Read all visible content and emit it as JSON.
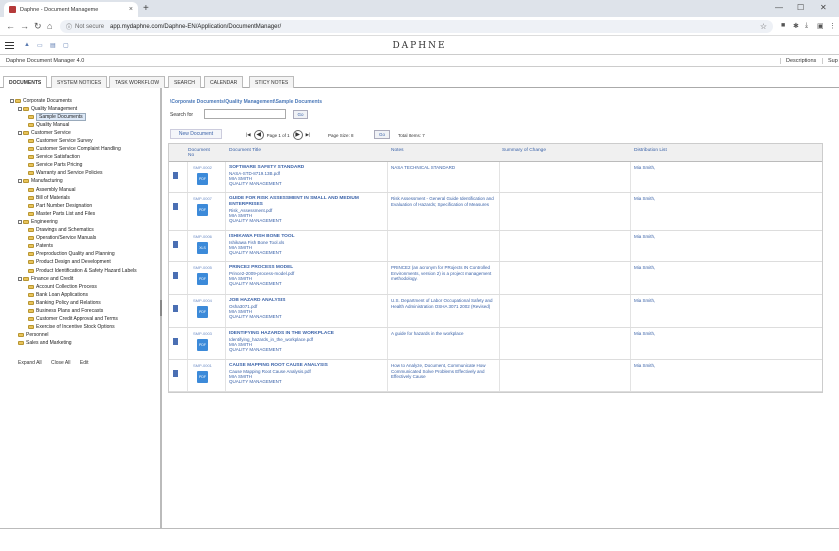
{
  "browser": {
    "tab_title": "Daphne - Document Manageme",
    "tab_close": "×",
    "new_tab": "+",
    "not_secure": "Not secure",
    "url": "app.mydaphne.com/Daphne-EN/Application/DocumentManager/"
  },
  "app": {
    "brand": "DAPHNE",
    "name_version": "Daphne Document Manager  4.0",
    "links": [
      "Descriptions",
      "Sup"
    ]
  },
  "tabs": [
    "DOCUMENTS",
    "SYSTEM NOTICES",
    "TASK WORKFLOW",
    "SEARCH",
    "CALENDAR",
    "STICY NOTES"
  ],
  "tree": {
    "root": "Corporate Documents",
    "items": [
      {
        "label": "Quality Management",
        "level": 1,
        "toggle": "-"
      },
      {
        "label": "Sample Documents",
        "level": 2,
        "selected": true
      },
      {
        "label": "Quality Manual",
        "level": 2
      },
      {
        "label": "Customer Service",
        "level": 1,
        "toggle": "-"
      },
      {
        "label": "Customer Service Survey",
        "level": 2
      },
      {
        "label": "Customer Service Complaint Handling",
        "level": 2
      },
      {
        "label": "Service Satisfaction",
        "level": 2
      },
      {
        "label": "Service Parts Pricing",
        "level": 2
      },
      {
        "label": "Warranty and Service Policies",
        "level": 2
      },
      {
        "label": "Manufacturing",
        "level": 1,
        "toggle": "-"
      },
      {
        "label": "Assembly Manual",
        "level": 2
      },
      {
        "label": "Bill of Materials",
        "level": 2
      },
      {
        "label": "Part Number Designation",
        "level": 2
      },
      {
        "label": "Master Parts List and Files",
        "level": 2
      },
      {
        "label": "Engineering",
        "level": 1,
        "toggle": "-"
      },
      {
        "label": "Drawings and Schematics",
        "level": 2
      },
      {
        "label": "Operation/Service Manuals",
        "level": 2
      },
      {
        "label": "Patents",
        "level": 2
      },
      {
        "label": "Preproduction Quality and Planning",
        "level": 2
      },
      {
        "label": "Product Design and Development",
        "level": 2
      },
      {
        "label": "Product Identification & Safety Hazard Labels",
        "level": 2
      },
      {
        "label": "Finance and Credit",
        "level": 1,
        "toggle": "-"
      },
      {
        "label": "Account Collection Process",
        "level": 2
      },
      {
        "label": "Bank Loan Applications",
        "level": 2
      },
      {
        "label": "Banking Policy and Relations",
        "level": 2
      },
      {
        "label": "Business Plans and Forecasts",
        "level": 2
      },
      {
        "label": "Customer Credit Approval and Terms",
        "level": 2
      },
      {
        "label": "Exercise of Incentive Stock Options",
        "level": 2
      },
      {
        "label": "Personnel",
        "level": 1
      },
      {
        "label": "Sales and Marketing",
        "level": 1
      }
    ],
    "links": [
      "Expand All",
      "Close All",
      "Edit"
    ]
  },
  "content": {
    "breadcrumb": "\\Corporate Documents\\Quality Management\\Sample Documents",
    "search_label": "Search for",
    "go": "Go",
    "new_document": "New Document",
    "page_info": "Page 1 of 1",
    "page_size": "Page Size: 8",
    "total_items": "Total Items: 7",
    "columns": [
      "Document No",
      "Document Title",
      "Notes",
      "Summary of Change",
      "Distribution List"
    ],
    "rows": [
      {
        "no": "SMP-0002",
        "title": "SOFTWARE SAFETY STANDARD",
        "file": "NASA-STD-8719.13B.pdf",
        "author": "MIA SMITH",
        "category": "QUALITY MANAGEMENT",
        "notes": "NASA TECHNICAL STANDARD",
        "dist": "Mia Smith,",
        "icon": "PDF",
        "height": 31
      },
      {
        "no": "SMP-0007",
        "title": "GUIDE FOR RISK ASSESSMENT IN SMALL AND MEDIUM ENTERPRISES",
        "file": "Risk_Assessment.pdf",
        "author": "MIA SMITH",
        "category": "QUALITY MANAGEMENT",
        "notes": "Risk Assessment - General Guide Identification and Evaluation of Hazards; Specification of Measures",
        "dist": "Mia Smith,",
        "icon": "PDF",
        "height": 38
      },
      {
        "no": "SMP-0006",
        "title": "ISHIKAWA FISH BONE TOOL",
        "file": "Ishikawa Fish Bone Tool.xls",
        "author": "MIA SMITH",
        "category": "QUALITY MANAGEMENT",
        "notes": "",
        "dist": "Mia Smith,",
        "icon": "XLS",
        "height": 31
      },
      {
        "no": "SMP-0005",
        "title": "PRINCE2 PROCESS MODEL",
        "file": "Prince2-2009-process-model.pdf",
        "author": "MIA SMITH",
        "category": "QUALITY MANAGEMENT",
        "notes": "PRINCE2 (an acronym for PRojects IN Controlled Environments, version 2) is a project management methodology.",
        "dist": "Mia Smith,",
        "icon": "PDF",
        "height": 33
      },
      {
        "no": "SMP-0004",
        "title": "JOB HAZARD ANALYSIS",
        "file": "Osha3071.pdf",
        "author": "MIA SMITH",
        "category": "QUALITY MANAGEMENT",
        "notes": "U.S. Department of Labor Occupational Safety and Health Administration OSHA 3071 2002 (Revised)",
        "dist": "Mia Smith,",
        "icon": "PDF",
        "height": 33
      },
      {
        "no": "SMP-0003",
        "title": "IDENTIFYING HAZARDS IN THE WORKPLACE",
        "file": "Identifying_hazards_in_the_workplace.pdf",
        "author": "MIA SMITH",
        "category": "QUALITY MANAGEMENT",
        "notes": "A guide for hazards in the workplace",
        "dist": "Mia Smith,",
        "icon": "PDF",
        "height": 32
      },
      {
        "no": "SMP-0001",
        "title": "CAUSE MAPPING ROOT CAUSE ANALYSIS",
        "file": "Cause Mapping Root Cause Analysis.pdf",
        "author": "MIA SMITH",
        "category": "QUALITY MANAGEMENT",
        "notes": "How to Analyze, Document, Communicate How Communicated Solve Problems Effectively and Effectively Cause",
        "dist": "Mia Smith,",
        "icon": "PDF",
        "height": 32
      }
    ]
  },
  "colors": {
    "link": "#3a62a8",
    "accent": "#4a78b8"
  },
  "icons": [
    "home-icon",
    "cart-icon",
    "grid-icon",
    "window-icon",
    "back-icon",
    "forward-icon",
    "reload-icon",
    "star-icon",
    "extension-icon"
  ]
}
